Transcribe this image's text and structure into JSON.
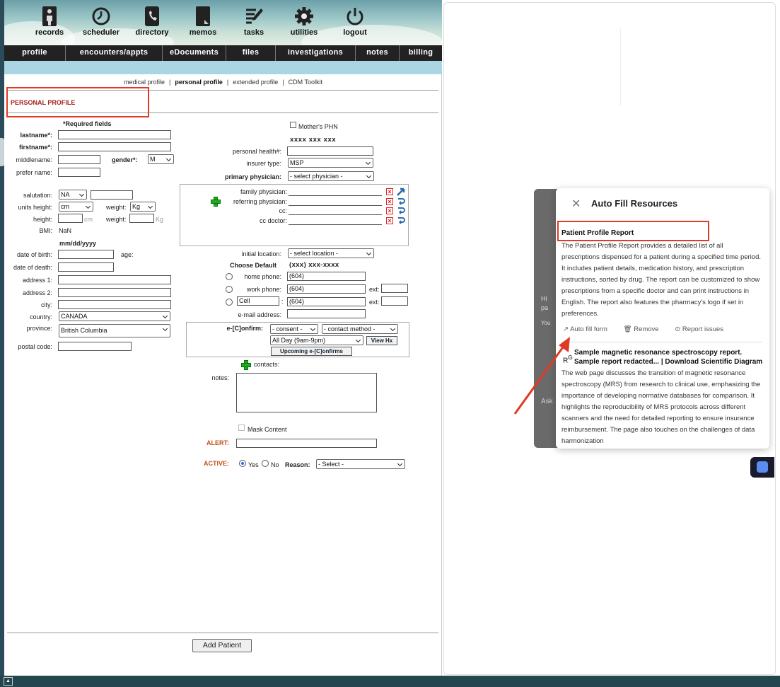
{
  "topnav": {
    "icons": [
      {
        "label": "records",
        "icon": "records-icon"
      },
      {
        "label": "scheduler",
        "icon": "clock-icon"
      },
      {
        "label": "directory",
        "icon": "phone-icon"
      },
      {
        "label": "memos",
        "icon": "memo-icon"
      },
      {
        "label": "tasks",
        "icon": "tasks-icon"
      },
      {
        "label": "utilities",
        "icon": "gear-icon"
      },
      {
        "label": "logout",
        "icon": "power-icon"
      }
    ]
  },
  "tabs": [
    "profile",
    "encounters/appts",
    "eDocuments",
    "files",
    "investigations",
    "notes",
    "billing"
  ],
  "sublinks": {
    "medical": "medical profile",
    "personal": "personal profile",
    "extended": "extended profile",
    "cdm": "CDM Toolkit",
    "sep": "|"
  },
  "section_title": "PERSONAL PROFILE",
  "form": {
    "required_note": "*Required fields",
    "lastname": "lastname*:",
    "firstname": "firstname*:",
    "middlename": "middlename:",
    "gender_label": "gender*:",
    "gender_value": "M",
    "prefer_name": "prefer name:",
    "salutation": "salutation:",
    "salutation_value": "NA",
    "units_height": "units height:",
    "units_height_value": "cm",
    "weight": "weight:",
    "weight_unit_value": "Kg",
    "height": "height:",
    "cm": "cm",
    "kg": "Kg",
    "bmi": "BMI:",
    "bmi_value": "NaN",
    "date_format": "mm/dd/yyyy",
    "dob": "date of birth:",
    "age": "age:",
    "dod": "date of death:",
    "address1": "address 1:",
    "address2": "address 2:",
    "city": "city:",
    "country": "country:",
    "country_value": "CANADA",
    "province": "province:",
    "province_value": "British Columbia",
    "postal_code": "postal code:",
    "mothers_phn": "Mother's PHN",
    "phn_format": "xxxx xxx xxx",
    "phn_label": "personal health#:",
    "insurer_label": "insurer type:",
    "insurer_value": "MSP",
    "primary_physician": "primary physician:",
    "primary_physician_value": "- select physician -",
    "family_physician": "family physician:",
    "referring_physician": "referring physician:",
    "cc": "cc:",
    "cc_doctor": "cc doctor:",
    "initial_location": "initial location:",
    "initial_location_value": "- select location -",
    "choose_default": "Choose Default",
    "phone_format": "(xxx) xxx-xxxx",
    "home_phone": "home phone:",
    "work_phone": "work phone:",
    "cell_value": "Cell",
    "phone_prefix": "(604)",
    "ext": "ext:",
    "email": "e-mail address:",
    "econfirm": "e-[C]onfirm:",
    "consent_value": "- consent -",
    "contact_method_value": "- contact method -",
    "allday_value": "All Day (9am-9pm)",
    "view_hx": "View Hx",
    "upcoming": "Upcoming e-[C]onfirms",
    "contacts": "contacts:",
    "notes": "notes:",
    "mask_content": "Mask Content",
    "alert": "ALERT:",
    "active": "ACTIVE:",
    "yes": "Yes",
    "no": "No",
    "reason": "Reason:",
    "reason_value": "- Select -",
    "add_patient": "Add Patient"
  },
  "popup": {
    "title": "Auto Fill Resources",
    "result1_title": "Patient Profile Report",
    "result1_body": "The Patient Profile Report provides a detailed list of all prescriptions dispensed for a patient during a specified time period. It includes patient details, medication history, and prescription instructions, sorted by drug. The report can be customized to show prescriptions from a specific doctor and can print instructions in English. The report also features the pharmacy's logo if set in preferences.",
    "auto_fill": "Auto fill form",
    "remove": "Remove",
    "report_issues": "Report issues",
    "result2_title": "Sample magnetic resonance spectroscopy report. Sample report redacted... | Download Scientific Diagram",
    "result2_body": "The web page discusses the transition of magnetic resonance spectroscopy (MRS) from research to clinical use, emphasizing the importance of developing normative databases for comparison. It highlights the reproducibility of MRS protocols across different scanners and the need for detailed reporting to ensure insurance reimbursement. The page also touches on the challenges of data harmonization"
  },
  "sidepane": {
    "hi": "Hi",
    "pa": "pa",
    "you": "You",
    "ask": "Ask"
  },
  "colors": {
    "accent_red": "#e03a24",
    "nav_bg": "#222222",
    "subbar": "#a9d6e2",
    "footer": "#24464f"
  }
}
